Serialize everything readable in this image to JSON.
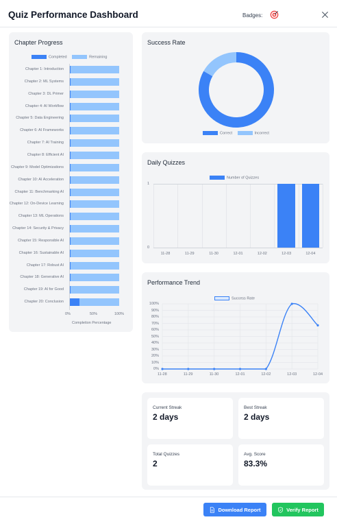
{
  "header": {
    "title": "Quiz Performance Dashboard",
    "badges_label": "Badges:",
    "badge_icon": "target-icon",
    "close_icon": "close-icon"
  },
  "colors": {
    "primary": "#3b82f6",
    "secondary": "#93c5fd",
    "green": "#22c55e"
  },
  "chapter_progress": {
    "title": "Chapter Progress",
    "chart_data": {
      "type": "bar",
      "orientation": "horizontal",
      "stacked": true,
      "categories": [
        "Chapter 1: Introduction",
        "Chapter 2: ML Systems",
        "Chapter 3: DL Primer",
        "Chapter 4: AI Workflow",
        "Chapter 5: Data Engineering",
        "Chapter 6: AI Frameworks",
        "Chapter 7: AI Training",
        "Chapter 8: Efficient AI",
        "Chapter 9: Model Optimizations",
        "Chapter 10: AI Acceleration",
        "Chapter 11: Benchmarking AI",
        "Chapter 12: On-Device Learning",
        "Chapter 13: ML Operations",
        "Chapter 14: Security & Privacy",
        "Chapter 15: Responsible AI",
        "Chapter 16: Sustainable AI",
        "Chapter 17: Robust AI",
        "Chapter 18: Generative AI",
        "Chapter 19: AI for Good",
        "Chapter 20: Conclusion"
      ],
      "series": [
        {
          "name": "Completed",
          "values": [
            1,
            1,
            1,
            1,
            1,
            1,
            1,
            1,
            1,
            1,
            1,
            1,
            1,
            1,
            1,
            1,
            1,
            1,
            1,
            20
          ]
        },
        {
          "name": "Remaining",
          "values": [
            99,
            99,
            99,
            99,
            99,
            99,
            99,
            99,
            99,
            99,
            99,
            99,
            99,
            99,
            99,
            99,
            99,
            99,
            99,
            80
          ]
        }
      ],
      "xlabel": "Completion Percentage",
      "xlim": [
        0,
        100
      ],
      "xticks": [
        "0%",
        "50%",
        "100%"
      ],
      "legend": "top"
    }
  },
  "success_rate": {
    "title": "Success Rate",
    "chart_data": {
      "type": "pie",
      "donut": true,
      "labels": [
        "Correct",
        "Incorrect"
      ],
      "values": [
        83.3,
        16.7
      ],
      "legend": "bottom"
    }
  },
  "daily_quizzes": {
    "title": "Daily Quizzes",
    "chart_data": {
      "type": "bar",
      "categories": [
        "11-28",
        "11-29",
        "11-30",
        "12-01",
        "12-02",
        "12-03",
        "12-04"
      ],
      "series": [
        {
          "name": "Number of Quizzes",
          "values": [
            0,
            0,
            0,
            0,
            0,
            1,
            1
          ]
        }
      ],
      "ylim": [
        0,
        1
      ],
      "yticks": [
        "0",
        "1"
      ],
      "legend": "top"
    }
  },
  "performance_trend": {
    "title": "Performance Trend",
    "chart_data": {
      "type": "line",
      "x": [
        "11-28",
        "11-29",
        "11-30",
        "12-01",
        "12-02",
        "12-03",
        "12-04"
      ],
      "series": [
        {
          "name": "Success Rate",
          "values": [
            0,
            0,
            0,
            0,
            0,
            100,
            67
          ]
        }
      ],
      "ylim": [
        0,
        100
      ],
      "yticks": [
        "0%",
        "10%",
        "20%",
        "30%",
        "40%",
        "50%",
        "60%",
        "70%",
        "80%",
        "90%",
        "100%"
      ],
      "grid": true,
      "legend": "top"
    }
  },
  "stats": [
    {
      "label": "Current Streak",
      "value": "2 days"
    },
    {
      "label": "Best Streak",
      "value": "2 days"
    },
    {
      "label": "Total Quizzes",
      "value": "2"
    },
    {
      "label": "Avg. Score",
      "value": "83.3%"
    }
  ],
  "footer": {
    "download_label": "Download Report",
    "download_icon": "document-icon",
    "verify_label": "Verify Report",
    "verify_icon": "shield-check-icon"
  }
}
